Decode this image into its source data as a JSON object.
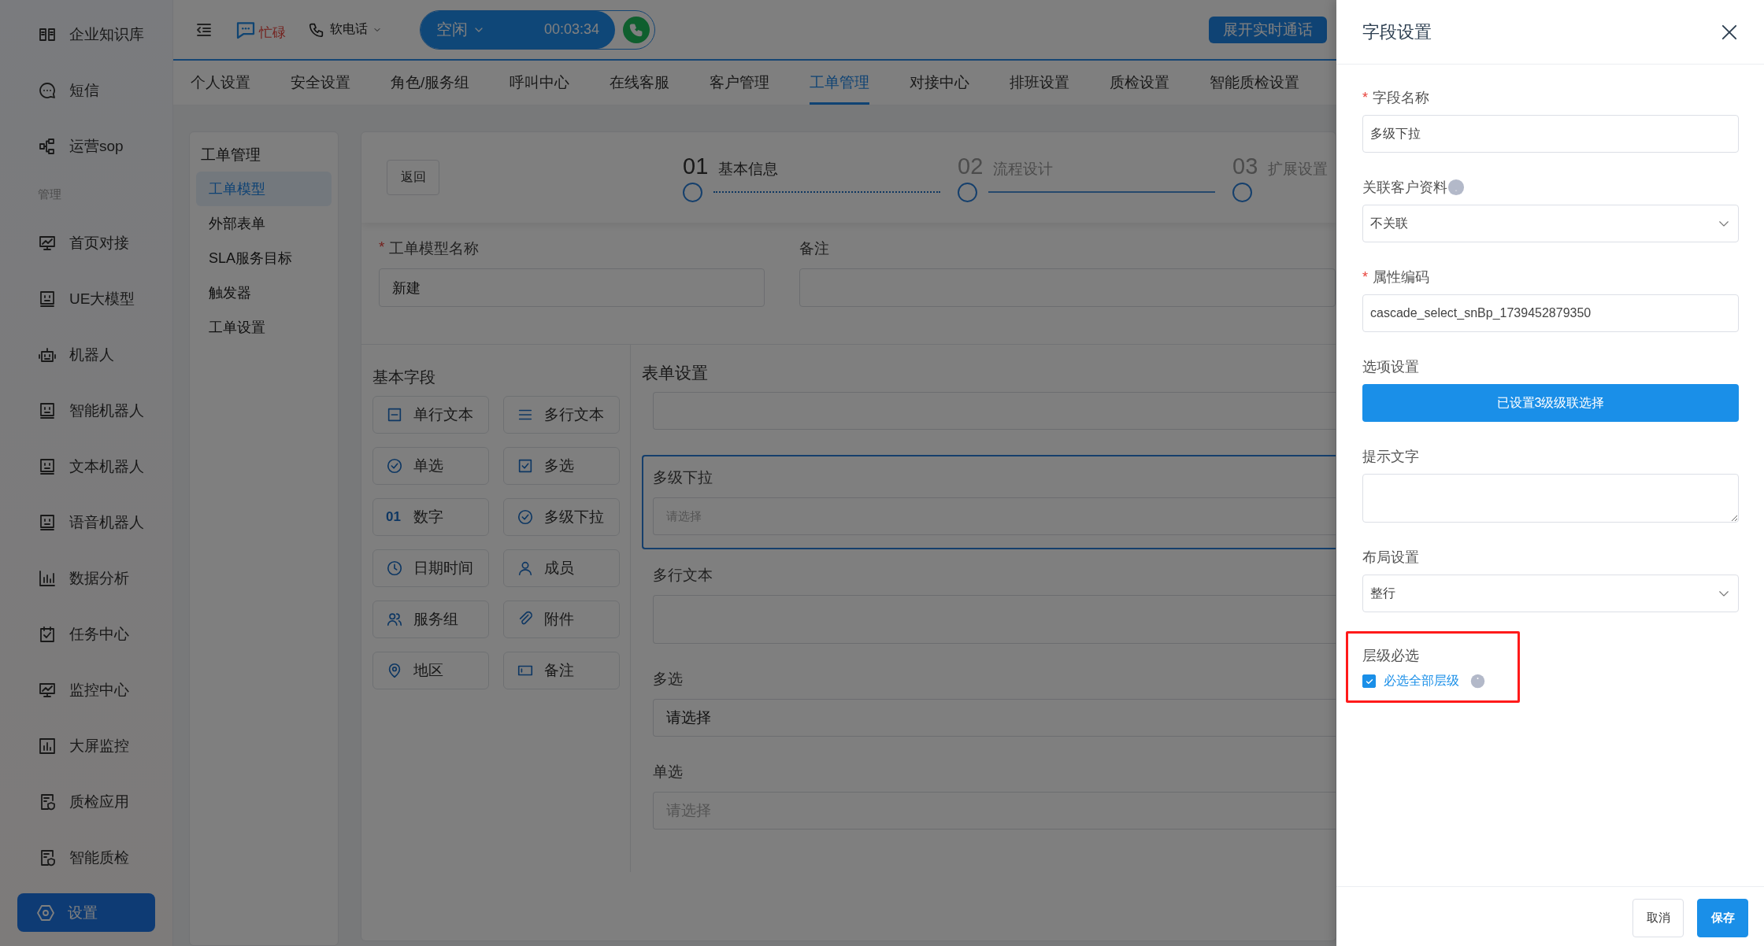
{
  "sidebar": {
    "items": [
      {
        "kind": "item",
        "label": "企业知识库",
        "selected": false
      },
      {
        "kind": "item",
        "label": "短信",
        "selected": false
      },
      {
        "kind": "item",
        "label": "运营sop",
        "selected": false
      },
      {
        "kind": "section",
        "label": "管理"
      },
      {
        "kind": "item",
        "label": "首页对接",
        "selected": false
      },
      {
        "kind": "item",
        "label": "UE大模型",
        "selected": false
      },
      {
        "kind": "item",
        "label": "机器人",
        "selected": false
      },
      {
        "kind": "item",
        "label": "智能机器人",
        "selected": false
      },
      {
        "kind": "item",
        "label": "文本机器人",
        "selected": false
      },
      {
        "kind": "item",
        "label": "语音机器人",
        "selected": false
      },
      {
        "kind": "item",
        "label": "数据分析",
        "selected": false
      },
      {
        "kind": "item",
        "label": "任务中心",
        "selected": false
      },
      {
        "kind": "item",
        "label": "监控中心",
        "selected": false
      },
      {
        "kind": "item",
        "label": "大屏监控",
        "selected": false
      },
      {
        "kind": "item",
        "label": "质检应用",
        "selected": false
      },
      {
        "kind": "item",
        "label": "智能质检",
        "selected": false
      },
      {
        "kind": "item",
        "label": "设置",
        "selected": true
      }
    ]
  },
  "header": {
    "busy_label": "忙碌",
    "phone_label": "软电话",
    "status": "空闲",
    "timer": "00:03:34",
    "expand_button": "展开实时通话"
  },
  "tabs": [
    {
      "label": "个人设置",
      "selected": false
    },
    {
      "label": "安全设置",
      "selected": false
    },
    {
      "label": "角色/服务组",
      "selected": false
    },
    {
      "label": "呼叫中心",
      "selected": false
    },
    {
      "label": "在线客服",
      "selected": false
    },
    {
      "label": "客户管理",
      "selected": false
    },
    {
      "label": "工单管理",
      "selected": true
    },
    {
      "label": "对接中心",
      "selected": false
    },
    {
      "label": "排班设置",
      "selected": false
    },
    {
      "label": "质检设置",
      "selected": false
    },
    {
      "label": "智能质检设置",
      "selected": false
    }
  ],
  "submenu": {
    "title": "工单管理",
    "items": [
      {
        "label": "工单模型",
        "selected": true
      },
      {
        "label": "外部表单",
        "selected": false
      },
      {
        "label": "SLA服务目标",
        "selected": false
      },
      {
        "label": "触发器",
        "selected": false
      },
      {
        "label": "工单设置",
        "selected": false
      }
    ]
  },
  "editor": {
    "back_button": "返回",
    "steps": [
      {
        "number": "01",
        "label": "基本信息",
        "active": true
      },
      {
        "number": "02",
        "label": "流程设计",
        "active": false
      },
      {
        "number": "03",
        "label": "扩展设置",
        "active": false
      }
    ],
    "name_field": {
      "label": "工单模型名称",
      "required": true,
      "required_mark": "*",
      "value": "新建"
    },
    "remark_field": {
      "label": "备注"
    },
    "palette": {
      "title": "基本字段",
      "fields": [
        {
          "label": "单行文本"
        },
        {
          "label": "多行文本"
        },
        {
          "label": "单选"
        },
        {
          "label": "多选"
        },
        {
          "label": "数字",
          "icon_text": "01"
        },
        {
          "label": "多级下拉"
        },
        {
          "label": "日期时间"
        },
        {
          "label": "成员"
        },
        {
          "label": "服务组"
        },
        {
          "label": "附件"
        },
        {
          "label": "地区"
        },
        {
          "label": "备注"
        }
      ]
    },
    "form": {
      "title": "表单设置",
      "fields": [
        {
          "kind": "input",
          "selected": false
        },
        {
          "kind": "select",
          "label": "多级下拉",
          "placeholder": "请选择",
          "selected": true
        },
        {
          "kind": "textarea",
          "label": "多行文本",
          "selected": false
        },
        {
          "kind": "select",
          "label": "多选",
          "value": "请选择",
          "selected": false
        },
        {
          "kind": "select",
          "label": "单选",
          "placeholder": "请选择",
          "selected": false
        }
      ]
    }
  },
  "drawer": {
    "modal": true,
    "title": "字段设置",
    "fields": [
      {
        "kind": "input",
        "label": "字段名称",
        "required": true,
        "required_mark": "*",
        "value": "多级下拉"
      },
      {
        "kind": "select",
        "label": "关联客户资料",
        "help": true,
        "value": "不关联"
      },
      {
        "kind": "input",
        "label": "属性编码",
        "required": true,
        "required_mark": "*",
        "value": "cascade_select_snBp_1739452879350"
      },
      {
        "kind": "button",
        "label": "选项设置",
        "button": "已设置3级级联选择"
      },
      {
        "kind": "textarea",
        "label": "提示文字"
      },
      {
        "kind": "select",
        "label": "布局设置",
        "value": "整行"
      },
      {
        "kind": "checkbox",
        "label": "层级必选",
        "highlighted": true,
        "option": "必选全部层级",
        "checked": true,
        "info": true
      }
    ],
    "buttons": [
      {
        "kind": "default",
        "label": "取消"
      },
      {
        "kind": "primary",
        "label": "保存"
      }
    ]
  }
}
